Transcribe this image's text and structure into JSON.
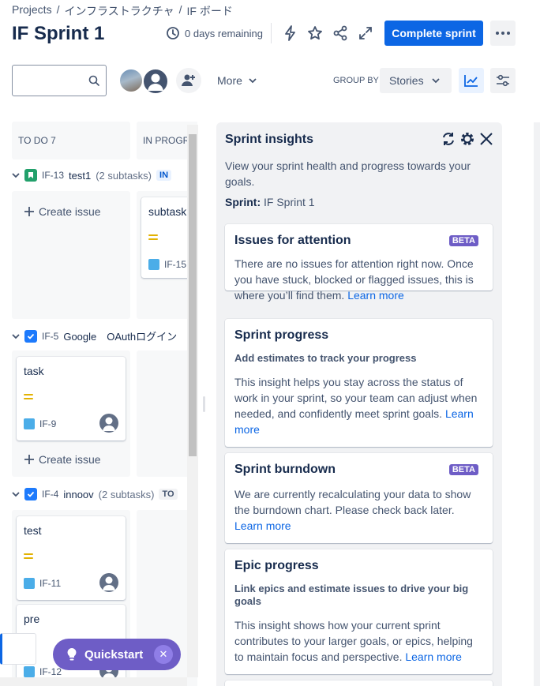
{
  "breadcrumb": [
    "Projects",
    "インフラストラクチャ",
    "IF ボード"
  ],
  "sprint": {
    "title": "IF Sprint 1",
    "remaining": "0 days remaining",
    "complete_label": "Complete sprint"
  },
  "toolbar": {
    "search_placeholder": "",
    "more_label": "More",
    "group_by_label": "GROUP BY",
    "group_by_value": "Stories"
  },
  "columns": [
    {
      "label": "TO DO 7"
    },
    {
      "label": "IN PROGR"
    }
  ],
  "swimlanes": [
    {
      "key": "IF-13",
      "title": "test1",
      "subtasks": "(2 subtasks)",
      "status": "IN"
    },
    {
      "key": "IF-5",
      "title": "Google　OAuthログイン",
      "subtasks": "",
      "status": ""
    },
    {
      "key": "IF-4",
      "title": "innoov",
      "subtasks": "(2 subtasks)",
      "status": "TO"
    }
  ],
  "cards": [
    {
      "title": "subtask",
      "key": "IF-15"
    },
    {
      "title": "task",
      "key": "IF-9"
    },
    {
      "title": "test",
      "key": "IF-11"
    },
    {
      "title": "pre",
      "key": "IF-12"
    }
  ],
  "create_issue_label": "Create issue",
  "insights": {
    "title": "Sprint insights",
    "description": "View your sprint health and progress towards your goals.",
    "sprint_label": "Sprint:",
    "sprint_value": "IF Sprint 1",
    "cards": [
      {
        "title": "Issues for attention",
        "badge": "BETA",
        "text": "There are no issues for attention right now. Once you have stuck, blocked or flagged issues, this is where you’ll find them.",
        "link": "Learn more"
      },
      {
        "title": "Sprint progress",
        "subtitle": "Add estimates to track your progress",
        "text": "This insight helps you stay across the status of work in your sprint, so your team can adjust when needed, and confidently meet sprint goals.",
        "link": "Learn more"
      },
      {
        "title": "Sprint burndown",
        "badge": "BETA",
        "text": "We are currently recalculating your data to show the burndown chart. Please check back later.",
        "link": "Learn more"
      },
      {
        "title": "Epic progress",
        "subtitle": "Link epics and estimate issues to drive your big goals",
        "text": "This insight shows how your current sprint contributes to your larger goals, or epics, helping to maintain focus and perspective.",
        "link": "Learn more"
      }
    ]
  },
  "quickstart_label": "Quickstart",
  "colors": {
    "primary": "#0c66e4",
    "beta": "#6e5dc6",
    "story_green": "#22a06b",
    "task_blue": "#1d7afc",
    "medium_priority": "#e2b203"
  }
}
